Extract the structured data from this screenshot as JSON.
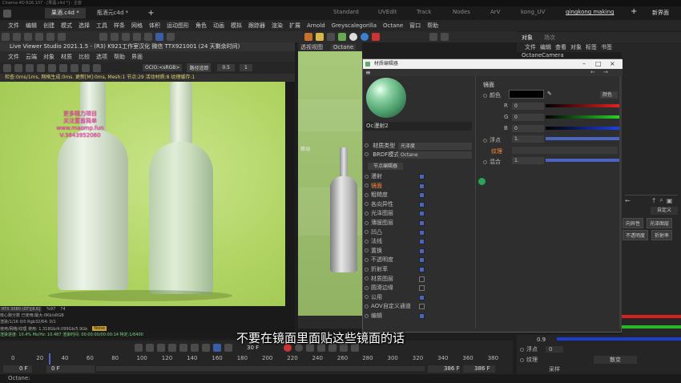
{
  "window": {
    "title": "Cinema 4D R26.107 - [果酒.c4d *] - 主窗"
  },
  "doc_tabs": [
    {
      "label": "果酒.c4d *",
      "active": true
    },
    {
      "label": "瓶酒元c4d *",
      "active": false
    }
  ],
  "layout_tabs": [
    {
      "label": "Standard",
      "active": false
    },
    {
      "label": "UVEdit",
      "active": false
    },
    {
      "label": "Track",
      "active": false
    },
    {
      "label": "Nodes",
      "active": false
    },
    {
      "label": "ArV",
      "active": false
    },
    {
      "label": "kong_UV",
      "active": false
    },
    {
      "label": "qingkong making",
      "active": true
    }
  ],
  "new_layout_label": "新界面",
  "main_menu": [
    "文件",
    "编辑",
    "创建",
    "模式",
    "选择",
    "工具",
    "样条",
    "网格",
    "体积",
    "运动图形",
    "角色",
    "动画",
    "模拟",
    "跟踪器",
    "渲染",
    "扩展",
    "Arnold",
    "Greyscalegorilla",
    "Octane",
    "窗口",
    "帮助"
  ],
  "live_viewer": {
    "title": "Live Viewer Studio 2021.1.5 - (R3)  K921工作室汉化 微信 TTX921001 (24 天剩余时间)",
    "menu": [
      "文件",
      "云端",
      "对象",
      "材质",
      "比较",
      "选项",
      "帮助",
      "界面"
    ],
    "ocio": "OCIO:<sRGB>",
    "display_mode": "路径追踪",
    "exposure": "0.5",
    "sample": "1",
    "status": "检查:0ms/1ms, 网格生成:0ms. 更新[M]:0ms, Mesh:1 节点:29 活动材质:8 纹理缓存:1",
    "watermark": [
      "更多精力项目",
      "关注置首简单",
      "www.maomp.fun",
      "V:3643952060"
    ],
    "gpu": "RTX 3080 (DT)[8.6]",
    "gpu_pct": "%97",
    "gpu_val": "74",
    "bottom_lines": [
      "核心跑分数 已使用/最大:0Kb/sRGB",
      "渲染/1/16  0/0          Rgb32/64: 0/1",
      "使用/网格/纹理 使用: 1.318Gb/4.099Gb/5.9Gb",
      "渲染进度: 10.4%  Ms/Hz: 10.487   渲染时间: 00:00:00/00:00:14   特定:1/6400"
    ],
    "bottom_note": "Noise"
  },
  "viewport2": {
    "label": "透视视图",
    "tab": "Octane",
    "move_label": "移动"
  },
  "material_editor": {
    "title": "材质编辑器",
    "material_name": "Oc漫射2",
    "material_type_label": "材质类型",
    "material_type_value": "光泽度",
    "brdf_label": "BRDF模式",
    "brdf_value": "Octane",
    "node_editor_btn": "节点编辑器",
    "channels": [
      {
        "label": "漫射",
        "checked": true,
        "highlight": false
      },
      {
        "label": "镜面",
        "checked": true,
        "highlight": true
      },
      {
        "label": "粗糙度",
        "checked": true,
        "highlight": false
      },
      {
        "label": "各向异性",
        "checked": true,
        "highlight": false
      },
      {
        "label": "光泽图层",
        "checked": true,
        "highlight": false
      },
      {
        "label": "薄膜图层",
        "checked": true,
        "highlight": false
      },
      {
        "label": "凹凸",
        "checked": true,
        "highlight": false
      },
      {
        "label": "法线",
        "checked": true,
        "highlight": false
      },
      {
        "label": "置换",
        "checked": true,
        "highlight": false
      },
      {
        "label": "不透明度",
        "checked": true,
        "highlight": false
      },
      {
        "label": "折射率",
        "checked": true,
        "highlight": false
      },
      {
        "label": "材质图层",
        "checked": false,
        "highlight": false
      },
      {
        "label": "圆滑边缘",
        "checked": false,
        "highlight": false
      },
      {
        "label": "公用",
        "checked": true,
        "highlight": false
      },
      {
        "label": "AOV自定义通道",
        "checked": false,
        "highlight": false
      },
      {
        "label": "编辑",
        "checked": true,
        "highlight": false
      }
    ],
    "section_title": "镜面",
    "color_label": "颜色",
    "r_label": "R",
    "r_value": "0",
    "g_label": "G",
    "g_value": "0",
    "b_label": "B",
    "b_value": "0",
    "float_label": "浮点",
    "float_value": "1.",
    "texture_label": "纹理",
    "mix_label": "混合",
    "mix_value": "1.",
    "color_preset": "颜色"
  },
  "objects_panel": {
    "tabs": [
      "对象",
      "场次"
    ],
    "menu": [
      "文件",
      "编辑",
      "查看",
      "对象",
      "标签",
      "书签"
    ],
    "first_item": "OctaneCamera"
  },
  "right_dock": {
    "custom_label": "自定义",
    "buttons": [
      "向异性",
      "光泽图层",
      "不透明度",
      "折射率"
    ],
    "b_value": "0.9",
    "float_label": "浮点",
    "float_value": "0",
    "texture_label": "纹理",
    "blend_label": "散变",
    "sample_label": "采样"
  },
  "timeline": {
    "ticks": [
      "0",
      "20",
      "40",
      "60",
      "80",
      "100",
      "120",
      "140",
      "160",
      "180",
      "200",
      "220",
      "240",
      "260",
      "280",
      "300",
      "320",
      "340",
      "360",
      "380"
    ],
    "frame_field": "30 F",
    "start_a": "0 F",
    "start_b": "0 F",
    "end_a": "386 F",
    "end_b": "386 F"
  },
  "subtitle": "不要在镜面里面贴这些镜面的话",
  "status_bar": "Octane:",
  "colors": {
    "accent": "#ff8b3d",
    "check": "#4a64c0",
    "red": "#d61f1f",
    "green": "#2bb52b",
    "blue": "#1f3ccf"
  }
}
